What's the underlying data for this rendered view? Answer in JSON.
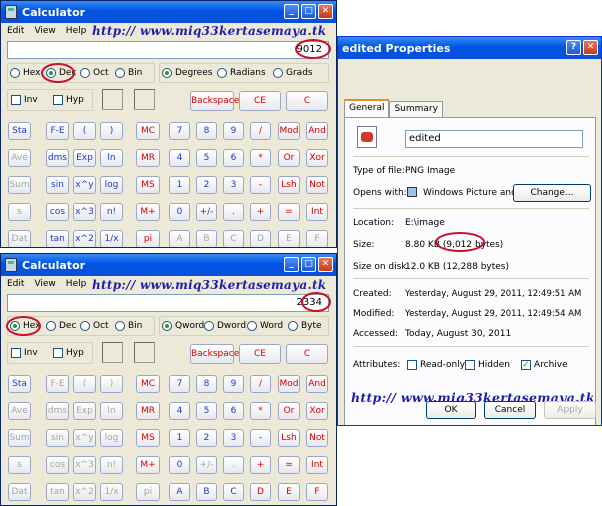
{
  "calc1": {
    "title": "Calculator",
    "menu": [
      "Edit",
      "View",
      "Help"
    ],
    "display": "9012",
    "bases": [
      "Hex",
      "Dec",
      "Oct",
      "Bin"
    ],
    "angles": [
      "Degrees",
      "Radians",
      "Grads"
    ],
    "inv": "Inv",
    "hyp": "Hyp",
    "top": [
      "Backspace",
      "CE",
      "C"
    ],
    "rows": [
      [
        "Sta",
        "F-E",
        "(",
        ")",
        "MC",
        "7",
        "8",
        "9",
        "/",
        "Mod",
        "And"
      ],
      [
        "Ave",
        "dms",
        "Exp",
        "ln",
        "MR",
        "4",
        "5",
        "6",
        "*",
        "Or",
        "Xor"
      ],
      [
        "Sum",
        "sin",
        "x^y",
        "log",
        "MS",
        "1",
        "2",
        "3",
        "-",
        "Lsh",
        "Not"
      ],
      [
        "s",
        "cos",
        "x^3",
        "n!",
        "M+",
        "0",
        "+/-",
        ".",
        "+",
        "=",
        "Int"
      ],
      [
        "Dat",
        "tan",
        "x^2",
        "1/x",
        "pi",
        "A",
        "B",
        "C",
        "D",
        "E",
        "F"
      ]
    ]
  },
  "calc2": {
    "title": "Calculator",
    "menu": [
      "Edit",
      "View",
      "Help"
    ],
    "display": "2334",
    "bases": [
      "Hex",
      "Dec",
      "Oct",
      "Bin"
    ],
    "words": [
      "Qword",
      "Dword",
      "Word",
      "Byte"
    ],
    "inv": "Inv",
    "hyp": "Hyp",
    "top": [
      "Backspace",
      "CE",
      "C"
    ],
    "rows": [
      [
        "Sta",
        "F-E",
        "(",
        ")",
        "MC",
        "7",
        "8",
        "9",
        "/",
        "Mod",
        "And"
      ],
      [
        "Ave",
        "dms",
        "Exp",
        "ln",
        "MR",
        "4",
        "5",
        "6",
        "*",
        "Or",
        "Xor"
      ],
      [
        "Sum",
        "sin",
        "x^y",
        "log",
        "MS",
        "1",
        "2",
        "3",
        "-",
        "Lsh",
        "Not"
      ],
      [
        "s",
        "cos",
        "x^3",
        "n!",
        "M+",
        "0",
        "+/-",
        ".",
        "+",
        "=",
        "Int"
      ],
      [
        "Dat",
        "tan",
        "x^2",
        "1/x",
        "pi",
        "A",
        "B",
        "C",
        "D",
        "E",
        "F"
      ]
    ]
  },
  "props": {
    "title": "edited Properties",
    "tabs": [
      "General",
      "Summary"
    ],
    "filename": "edited",
    "type_label": "Type of file:",
    "type_value": "PNG Image",
    "opens_label": "Opens with:",
    "opens_value": "Windows Picture and Fa",
    "change_btn": "Change...",
    "location_label": "Location:",
    "location_value": "E:\\image",
    "size_label": "Size:",
    "size_value": "8.80 KB (",
    "size_bytes": "9,012 bytes)",
    "disk_label": "Size on disk:",
    "disk_value": "12.0 KB (12,288 bytes)",
    "created_label": "Created:",
    "created_value": "Yesterday, August 29, 2011, 12:49:51 AM",
    "modified_label": "Modified:",
    "modified_value": "Yesterday, August 29, 2011, 12:49:54 AM",
    "accessed_label": "Accessed:",
    "accessed_value": "Today, August 30, 2011",
    "attr_label": "Attributes:",
    "readonly": "Read-only",
    "hidden": "Hidden",
    "archive": "Archive",
    "ok": "OK",
    "cancel": "Cancel",
    "apply": "Apply"
  },
  "watermark": "http:// www.miq33kertasemaya.tk",
  "accent": "#c8102e"
}
